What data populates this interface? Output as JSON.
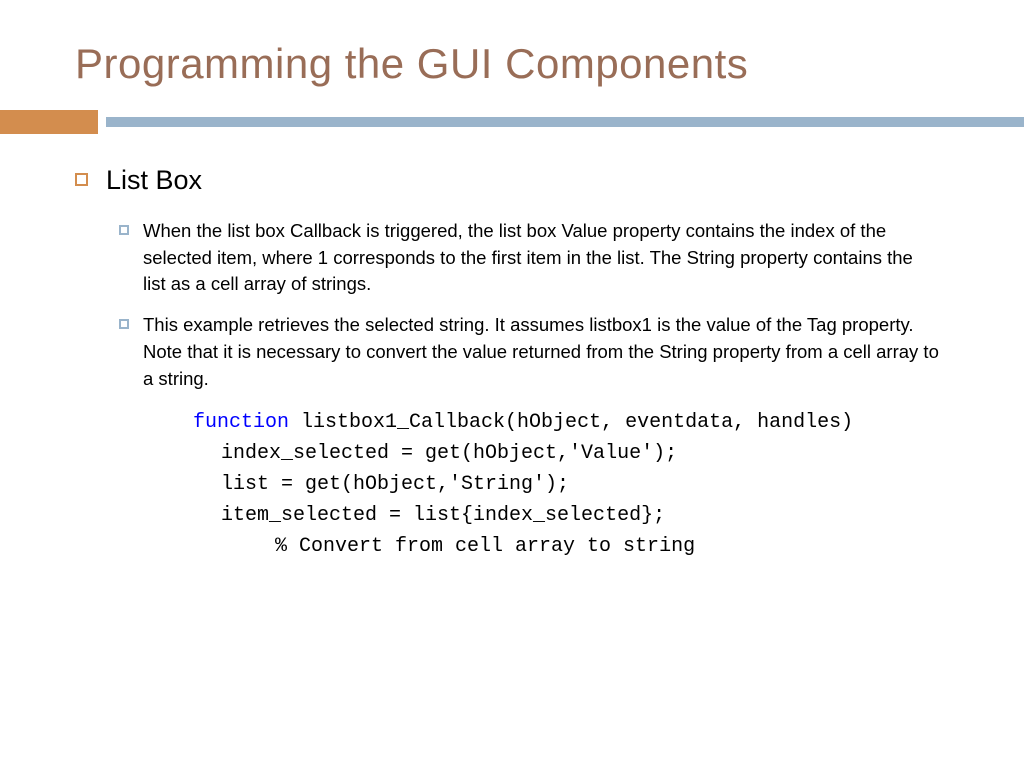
{
  "title": "Programming the GUI Components",
  "colors": {
    "title": "#996d57",
    "orange": "#d38d4e",
    "blue": "#9ab4cb",
    "keyword": "#0000ff"
  },
  "section_heading": "List Box",
  "bullets": [
    "When the list box Callback is triggered, the list box Value property contains the index of the selected item, where 1 corresponds to the first item in the list. The String property contains the list as a cell array of strings.",
    "This example retrieves the selected string. It assumes listbox1 is the value of the Tag property. Note that it is necessary to convert the value returned from the String property from a cell array to a string."
  ],
  "code": {
    "keyword": "function",
    "signature": " listbox1_Callback(hObject, eventdata, handles)",
    "lines": [
      "index_selected = get(hObject,'Value');",
      "list = get(hObject,'String');",
      "item_selected = list{index_selected};"
    ],
    "comment": "% Convert from cell array to string"
  }
}
